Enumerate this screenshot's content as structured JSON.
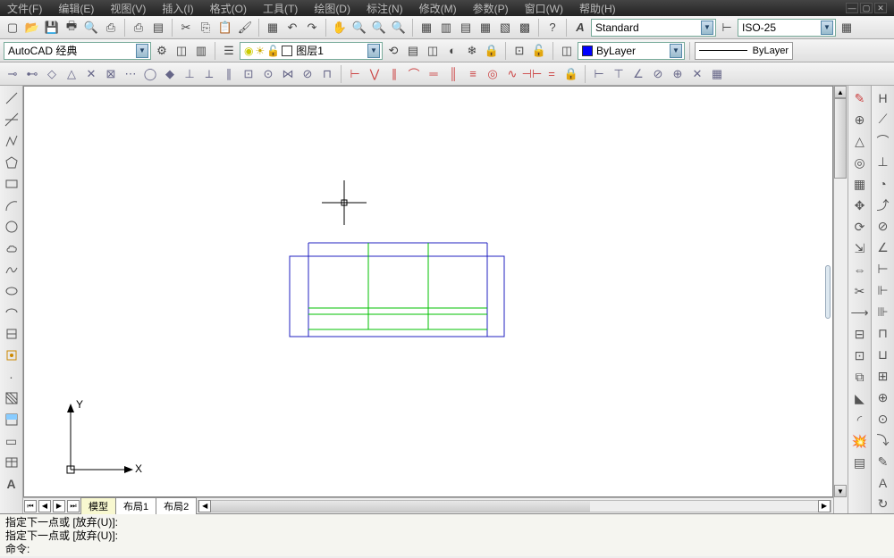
{
  "menu": {
    "items": [
      "文件(F)",
      "编辑(E)",
      "视图(V)",
      "插入(I)",
      "格式(O)",
      "工具(T)",
      "绘图(D)",
      "标注(N)",
      "修改(M)",
      "参数(P)",
      "窗口(W)",
      "帮助(H)"
    ]
  },
  "row1": {
    "workspace": "AutoCAD 经典",
    "layer": "图层1",
    "style": "Standard",
    "dimstyle": "ISO-25"
  },
  "row2": {
    "lineprop": "ByLayer",
    "lineweight": "ByLayer"
  },
  "tabs": {
    "model": "模型",
    "layout1": "布局1",
    "layout2": "布局2"
  },
  "cmd": {
    "l1": "指定下一点或  [放弃(U)]:",
    "l2": "指定下一点或  [放弃(U)]:",
    "prompt": "命令:"
  },
  "ucs": {
    "x": "X",
    "y": "Y"
  },
  "icons": {
    "left": [
      "╱",
      "╱",
      "⌒",
      "□",
      "◇",
      "○",
      "⌒",
      "◯",
      "∾",
      "∿",
      "○",
      "◐",
      "◉",
      "▭",
      "▭",
      "⊡",
      "⊞",
      "A"
    ],
    "right1": [
      "✎",
      "⊕",
      "✂",
      "▭",
      "⊡",
      "⟳",
      "⊖",
      "⇔",
      "▭",
      "▣",
      "◫",
      "⊟",
      "⊞",
      "⊡",
      "▢",
      "◧",
      "◨",
      "▭",
      "◫"
    ],
    "right2": [
      "⊢",
      "⌒",
      "△",
      "◯",
      "⊡",
      "○",
      "⊙",
      "△",
      "▽",
      "⊢",
      "⊣",
      "⊥",
      "⊤",
      "◫",
      "○",
      "△"
    ],
    "right3": [
      "H",
      "⊢",
      "⊥",
      "⊿",
      "△",
      "⋀",
      "⊙",
      "⊡",
      "R",
      "⊘",
      "⊕",
      "□",
      "◫",
      "⊢",
      "⊣"
    ]
  }
}
